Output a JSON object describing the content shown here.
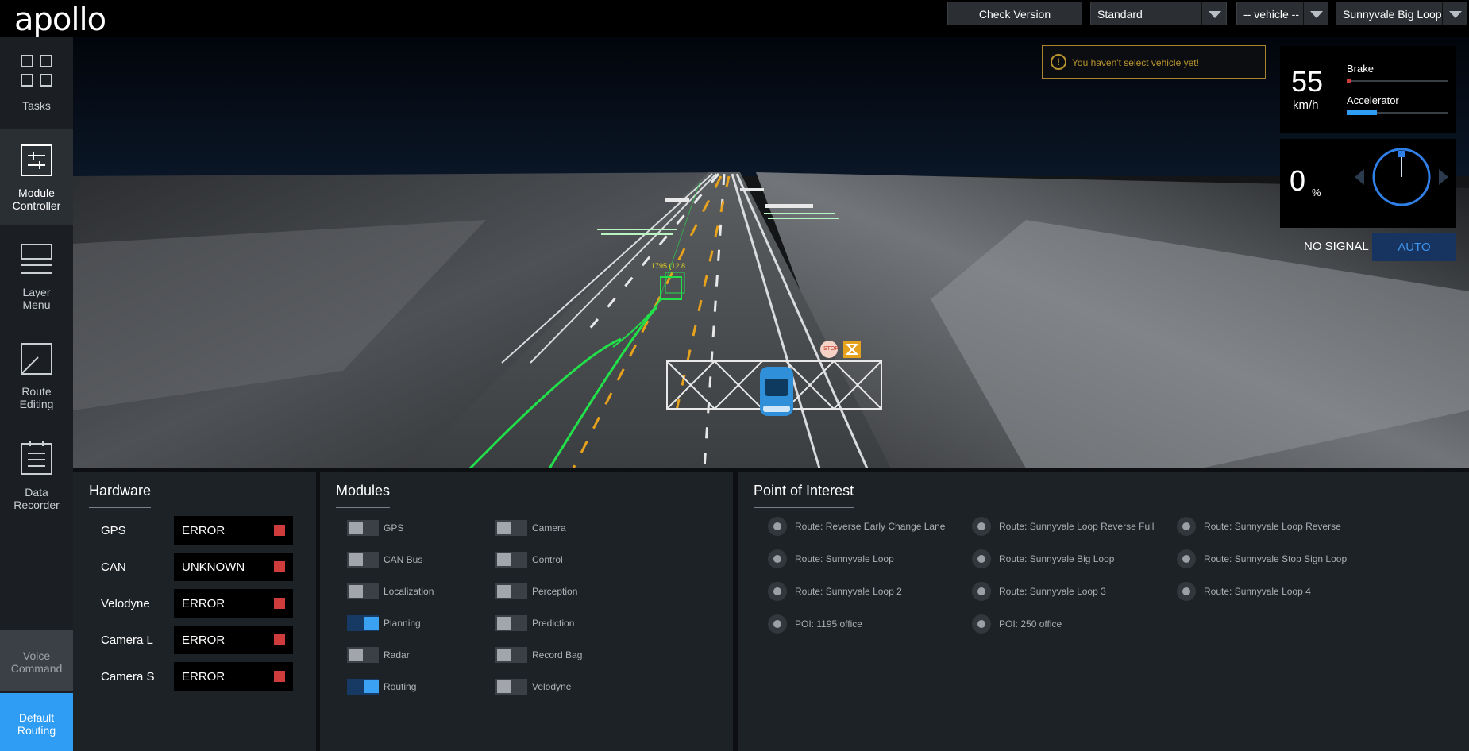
{
  "header": {
    "logo": "apollo",
    "check_version": "Check Version",
    "mode_select": "Standard",
    "vehicle_select": "-- vehicle --",
    "map_select": "Sunnyvale Big Loop"
  },
  "sidebar": {
    "items": [
      {
        "label_line1": "Tasks",
        "label_line2": ""
      },
      {
        "label_line1": "Module",
        "label_line2": "Controller"
      },
      {
        "label_line1": "Layer",
        "label_line2": "Menu"
      },
      {
        "label_line1": "Route",
        "label_line2": "Editing"
      },
      {
        "label_line1": "Data",
        "label_line2": "Recorder"
      }
    ],
    "voice_command": {
      "line1": "Voice",
      "line2": "Command"
    },
    "default_routing": {
      "line1": "Default",
      "line2": "Routing"
    }
  },
  "viewport": {
    "warning": "You haven't select vehicle yet!",
    "obstacle_label": "1795 (12.8",
    "stop_sign": "STOP"
  },
  "dashboard": {
    "speed": "55",
    "speed_unit": "km/h",
    "brake_label": "Brake",
    "brake_level": 0.04,
    "accelerator_label": "Accelerator",
    "accelerator_level": 0.3,
    "steering_value": "0",
    "steering_unit": "%",
    "signal": "NO SIGNAL",
    "drive_mode": "AUTO"
  },
  "hardware": {
    "title": "Hardware",
    "rows": [
      {
        "name": "GPS",
        "status": "ERROR"
      },
      {
        "name": "CAN",
        "status": "UNKNOWN"
      },
      {
        "name": "Velodyne",
        "status": "ERROR"
      },
      {
        "name": "Camera L",
        "status": "ERROR"
      },
      {
        "name": "Camera S",
        "status": "ERROR"
      }
    ]
  },
  "modules": {
    "title": "Modules",
    "col1": [
      {
        "name": "GPS",
        "on": false
      },
      {
        "name": "CAN Bus",
        "on": false
      },
      {
        "name": "Localization",
        "on": false
      },
      {
        "name": "Planning",
        "on": true
      },
      {
        "name": "Radar",
        "on": false
      },
      {
        "name": "Routing",
        "on": true
      }
    ],
    "col2": [
      {
        "name": "Camera",
        "on": false
      },
      {
        "name": "Control",
        "on": false
      },
      {
        "name": "Perception",
        "on": false
      },
      {
        "name": "Prediction",
        "on": false
      },
      {
        "name": "Record Bag",
        "on": false
      },
      {
        "name": "Velodyne",
        "on": false
      }
    ]
  },
  "poi": {
    "title": "Point of Interest",
    "items": [
      "Route: Reverse Early Change Lane",
      "Route: Sunnyvale Loop Reverse Full",
      "Route: Sunnyvale Loop Reverse",
      "Route: Sunnyvale Loop",
      "Route: Sunnyvale Big Loop",
      "Route: Sunnyvale Stop Sign Loop",
      "Route: Sunnyvale Loop 2",
      "Route: Sunnyvale Loop 3",
      "Route: Sunnyvale Loop 4",
      "POI: 1195 office",
      "POI: 250 office"
    ]
  },
  "colors": {
    "accent_blue": "#2f9df4",
    "error_red": "#cf3c3c",
    "warning_gold": "#b8942f",
    "lane_green": "#22e04a",
    "lane_yellow": "#e6a11d"
  }
}
